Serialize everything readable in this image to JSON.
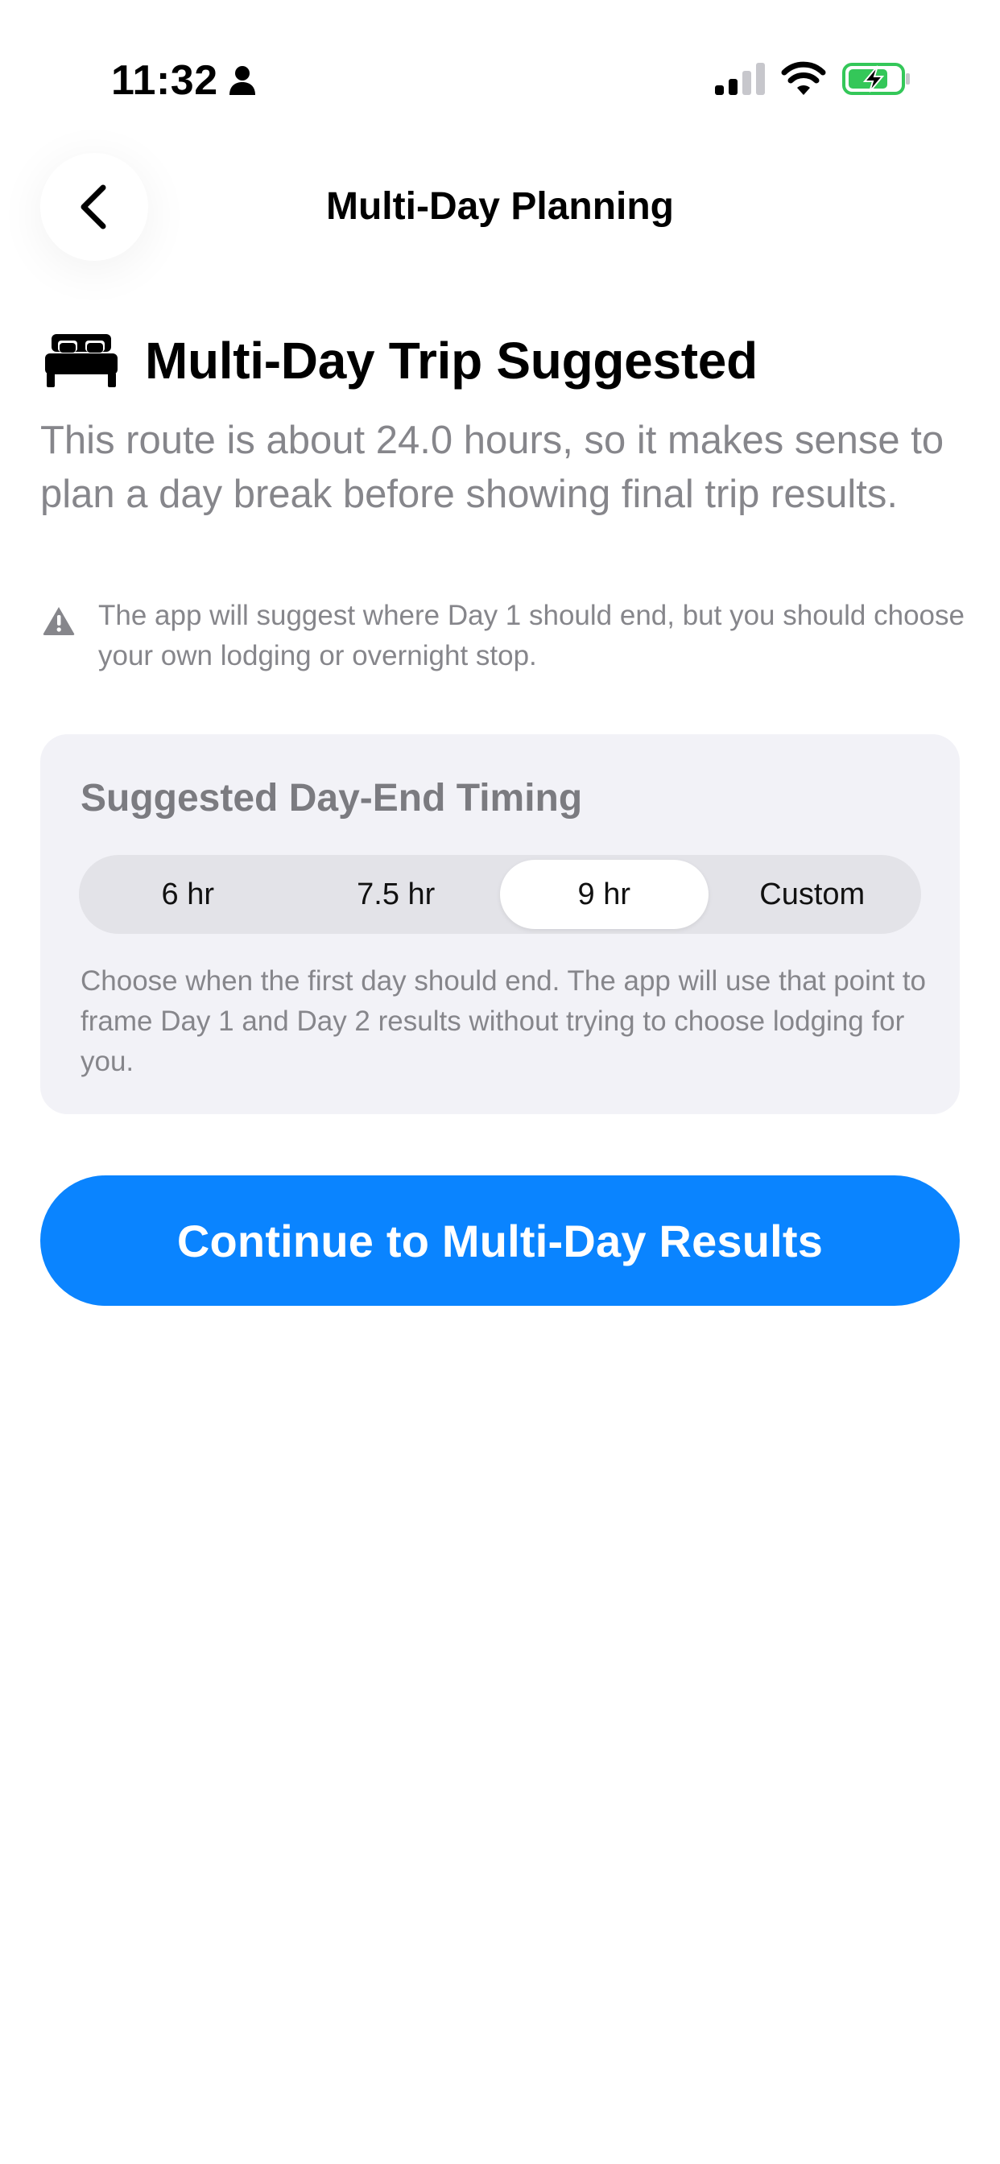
{
  "status_bar": {
    "time": "11:32",
    "battery_color": "#34c759"
  },
  "nav": {
    "title": "Multi-Day Planning"
  },
  "heading": {
    "title": "Multi-Day Trip Suggested",
    "icon": "bed-icon"
  },
  "description": "This route is about 24.0 hours, so it makes sense to plan a day break before showing final trip results.",
  "warning": {
    "icon": "warning-triangle-icon",
    "text": "The app will suggest where Day 1 should end, but you should choose your own lodging or overnight stop."
  },
  "timing_card": {
    "title": "Suggested Day-End Timing",
    "options": [
      "6 hr",
      "7.5 hr",
      "9 hr",
      "Custom"
    ],
    "selected_index": 2,
    "help_text": "Choose when the first day should end. The app will use that point to frame Day 1 and Day 2 results without trying to choose lodging for you."
  },
  "primary_button": {
    "label": "Continue to Multi-Day Results",
    "color": "#0a84ff"
  }
}
